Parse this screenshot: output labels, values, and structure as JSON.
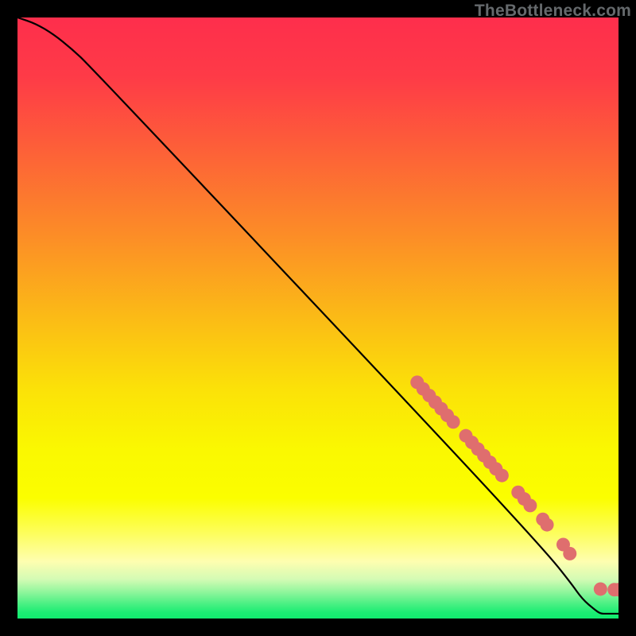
{
  "watermark": "TheBottleneck.com",
  "colors": {
    "marker": "#df6e6e",
    "curve": "#000000"
  },
  "chart_data": {
    "type": "line",
    "title": "",
    "xlabel": "",
    "ylabel": "",
    "xlim": [
      0,
      100
    ],
    "ylim": [
      0,
      100
    ],
    "curve": [
      {
        "x": 0,
        "y": 100
      },
      {
        "x": 3,
        "y": 99
      },
      {
        "x": 6,
        "y": 97.2
      },
      {
        "x": 9,
        "y": 94.8
      },
      {
        "x": 12,
        "y": 92
      },
      {
        "x": 70,
        "y": 30.5
      },
      {
        "x": 88,
        "y": 11
      },
      {
        "x": 92,
        "y": 6
      },
      {
        "x": 94,
        "y": 3.2
      },
      {
        "x": 96,
        "y": 1.5
      },
      {
        "x": 97,
        "y": 0.8
      },
      {
        "x": 98,
        "y": 0.8
      },
      {
        "x": 99.5,
        "y": 0.8
      },
      {
        "x": 100,
        "y": 0.8
      }
    ],
    "markers": [
      {
        "x": 66.5,
        "y": 39.3
      },
      {
        "x": 67.5,
        "y": 38.2
      },
      {
        "x": 68.5,
        "y": 37.1
      },
      {
        "x": 69.5,
        "y": 36.0
      },
      {
        "x": 70.5,
        "y": 34.9
      },
      {
        "x": 71.5,
        "y": 33.8
      },
      {
        "x": 72.5,
        "y": 32.7
      },
      {
        "x": 74.6,
        "y": 30.4
      },
      {
        "x": 75.6,
        "y": 29.3
      },
      {
        "x": 76.6,
        "y": 28.2
      },
      {
        "x": 77.6,
        "y": 27.1
      },
      {
        "x": 78.6,
        "y": 26.0
      },
      {
        "x": 79.6,
        "y": 24.9
      },
      {
        "x": 80.6,
        "y": 23.8
      },
      {
        "x": 83.3,
        "y": 21.0
      },
      {
        "x": 84.3,
        "y": 19.9
      },
      {
        "x": 85.3,
        "y": 18.8
      },
      {
        "x": 87.4,
        "y": 16.5
      },
      {
        "x": 88.1,
        "y": 15.6
      },
      {
        "x": 90.8,
        "y": 12.3
      },
      {
        "x": 91.9,
        "y": 10.8
      },
      {
        "x": 97.0,
        "y": 4.9
      },
      {
        "x": 99.3,
        "y": 4.8
      },
      {
        "x": 100.0,
        "y": 4.8
      }
    ],
    "gradient_stops": [
      {
        "pos": 0.0,
        "color": "#fe2e4c"
      },
      {
        "pos": 0.1,
        "color": "#fe3b47"
      },
      {
        "pos": 0.22,
        "color": "#fd6038"
      },
      {
        "pos": 0.36,
        "color": "#fc8c27"
      },
      {
        "pos": 0.5,
        "color": "#fbbb16"
      },
      {
        "pos": 0.62,
        "color": "#fbe208"
      },
      {
        "pos": 0.72,
        "color": "#faf801"
      },
      {
        "pos": 0.8,
        "color": "#fbfe00"
      },
      {
        "pos": 0.855,
        "color": "#fdfe57"
      },
      {
        "pos": 0.905,
        "color": "#fefeb0"
      },
      {
        "pos": 0.935,
        "color": "#d3fbb4"
      },
      {
        "pos": 0.955,
        "color": "#93f69d"
      },
      {
        "pos": 0.975,
        "color": "#4cf084"
      },
      {
        "pos": 0.99,
        "color": "#1ced73"
      },
      {
        "pos": 1.0,
        "color": "#11ec6f"
      }
    ]
  }
}
